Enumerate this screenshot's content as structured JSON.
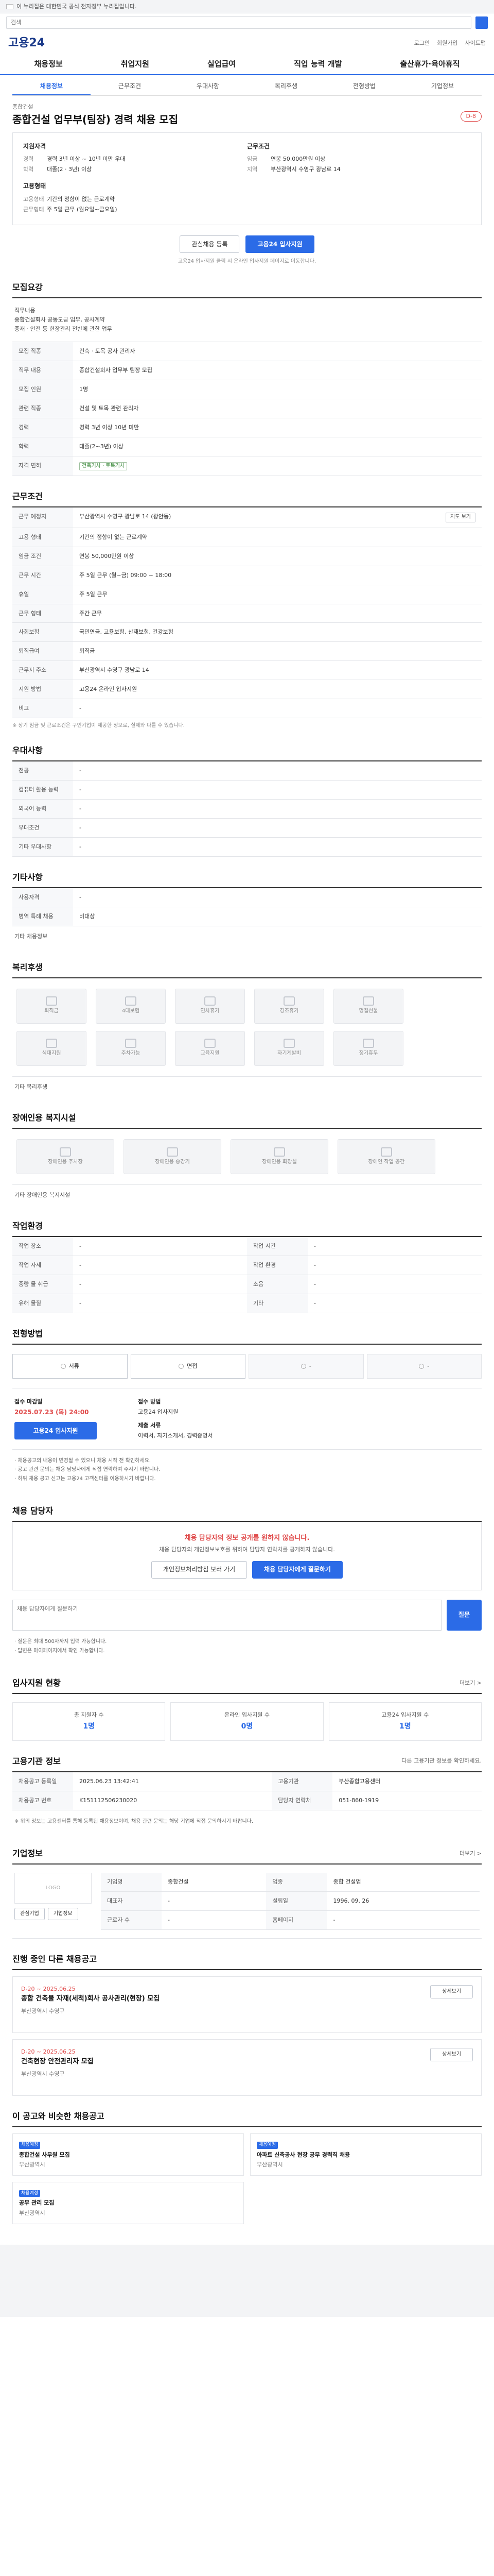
{
  "gov_banner": {
    "text": "이 누리집은 대한민국 공식 전자정부 누리집입니다."
  },
  "search": {
    "placeholder": "검색"
  },
  "header": {
    "logo": "고용24",
    "links": [
      "로그인",
      "회원가입",
      "사이트맵"
    ],
    "gnb": [
      "채용정보",
      "취업지원",
      "실업급여",
      "직업 능력 개발",
      "출산휴가·육아휴직"
    ]
  },
  "tabs": [
    "채용정보",
    "근무조건",
    "우대사항",
    "복리후생",
    "전형방법",
    "기업정보"
  ],
  "job": {
    "company": "종합건설",
    "title": "종합건설 업무부(팀장) 경력 채용 모집",
    "dday": "D-8"
  },
  "summary": {
    "left_title": "지원자격",
    "left": [
      {
        "k": "경력",
        "v": "경력 3년 이상 ~ 10년 미만 우대"
      },
      {
        "k": "학력",
        "v": "대졸(2 · 3년) 이상"
      }
    ],
    "left2_title": "고용형태",
    "left2": [
      {
        "k": "고용형태",
        "v": "기간의 정함이 없는 근로계약"
      },
      {
        "k": "근무형태",
        "v": "주 5일 근무 (월요일~금요일)"
      }
    ],
    "right_title": "근무조건",
    "right": [
      {
        "k": "임금",
        "v": "연봉 50,000만원 이상"
      },
      {
        "k": "지역",
        "v": "부산광역시 수영구 광남로 14"
      }
    ]
  },
  "actions": {
    "scrap": "관심채용 등록",
    "apply": "고용24 입사지원"
  },
  "notice": "고용24 입사지원 클릭 시 온라인 입사지원 페이지로 이동합니다.",
  "sections": {
    "recruit": "모집요강",
    "work": "근무조건",
    "pref": "우대사항",
    "other": "기타사항",
    "benefit": "복리후생",
    "disabled": "장애인용 복지시설",
    "workplace": "작업환경",
    "process": "전형방법",
    "contact": "채용 담당자",
    "status": "입사지원 현황",
    "org": "고용기관 정보",
    "company": "기업정보",
    "ongoing": "진행 중인 다른 채용공고",
    "recommend": "이 공고와 비슷한 채용공고"
  },
  "recruit_free": [
    "직무내용",
    "종합건설회사 공동도급 업무, 공사계약",
    "중재 · 안전 등 현장관리 전반에 관한 업무"
  ],
  "recruit_table": [
    {
      "k": "모집 직종",
      "v": "건축 · 토목 공사 관리자"
    },
    {
      "k": "직무 내용",
      "v": "종합건설회사 업무부 팀장 모집"
    },
    {
      "k": "모집 인원",
      "v": "1명"
    },
    {
      "k": "관련 직종",
      "v": "건설 및 토목 관련 관리자"
    },
    {
      "k": "경력",
      "v": "경력 3년 이상 10년 미만"
    },
    {
      "k": "학력",
      "v": "대졸(2~3년) 이상"
    },
    {
      "k": "자격 면허",
      "v": "건축기사 · 토목기사"
    }
  ],
  "work_table": [
    {
      "k": "근무 예정지",
      "v": "부산광역시 수영구 광남로 14 (광안동)"
    },
    {
      "k": "고용 형태",
      "v": "기간의 정함이 없는 근로계약"
    },
    {
      "k": "임금 조건",
      "v": "연봉 50,000만원 이상"
    },
    {
      "k": "근무 시간",
      "v": "주 5일 근무 (월~금) 09:00 ~ 18:00"
    },
    {
      "k": "휴일",
      "v": "주 5일 근무"
    },
    {
      "k": "근무 형태",
      "v": "주간 근무"
    },
    {
      "k": "사회보험",
      "v": "국민연금, 고용보험, 산재보험, 건강보험"
    },
    {
      "k": "퇴직급여",
      "v": "퇴직금"
    },
    {
      "k": "근무지 주소",
      "v": "부산광역시 수영구 광남로 14"
    },
    {
      "k": "지원 방법",
      "v": "고용24 온라인 입사지원"
    },
    {
      "k": "비고",
      "v": "-"
    }
  ],
  "work_note": "※ 상기 임금 및 근로조건은 구인기업이 제공한 정보로, 실제와 다를 수 있습니다.",
  "map_button": "지도 보기",
  "pref_table": [
    {
      "k": "전공",
      "v": "-"
    },
    {
      "k": "컴퓨터 활용 능력",
      "v": "-"
    },
    {
      "k": "외국어 능력",
      "v": "-"
    },
    {
      "k": "우대조건",
      "v": "-"
    },
    {
      "k": "기타 우대사항",
      "v": "-"
    }
  ],
  "other_table": [
    {
      "k": "사용자격",
      "v": "-"
    },
    {
      "k": "병역 특례 채용",
      "v": "비대상"
    }
  ],
  "other_link": "기타 채용정보",
  "benefits": [
    "퇴직금",
    "4대보험",
    "연차휴가",
    "경조휴가",
    "명절선물",
    "식대지원",
    "주차가능",
    "교육지원",
    "자기계발비",
    "정기휴무"
  ],
  "benefit_etc": "기타 복리후생",
  "disabled": [
    "장애인용 주차장",
    "장애인용 승강기",
    "장애인용 화장실",
    "장애인 작업 공간"
  ],
  "disabled_etc": "기타 장애인용 복지시설",
  "workplace_table": [
    {
      "k": "작업 장소",
      "v": "-",
      "k2": "작업 시간",
      "v2": "-"
    },
    {
      "k": "작업 자세",
      "v": "-",
      "k2": "작업 환경",
      "v2": "-"
    },
    {
      "k": "중량 물 취급",
      "v": "-",
      "k2": "소음",
      "v2": "-"
    },
    {
      "k": "유해 물질",
      "v": "-",
      "k2": "기타",
      "v2": "-"
    }
  ],
  "process_steps": [
    "서류",
    "면접",
    "-",
    "-"
  ],
  "apply": {
    "deadline_label": "접수 마감일",
    "deadline": "2025.07.23 (목) 24:00",
    "method_label": "접수 방법",
    "method": "고용24 입사지원",
    "docs_label": "제출 서류",
    "docs": "이력서, 자기소개서, 경력증명서",
    "button": "고용24 입사지원"
  },
  "apply_notes": [
    "· 채용공고의 내용이 변경될 수 있으니 채용 시작 전 확인하세요.",
    "· 공고 관련 문의는 채용 담당자에게 직접 연락하여 주시기 바랍니다.",
    "· 허위 채용 공고 신고는 고용24 고객센터를 이용하시기 바랍니다."
  ],
  "contact": {
    "alert": "채용 담당자의 정보 공개를 원하지 않습니다.",
    "alert_text": "채용 담당자의 개인정보보호를 위하여 담당자 연락처를 공개하지 않습니다.",
    "btn1": "개인정보처리방침 보러 가기",
    "btn2": "채용 담당자에게 질문하기",
    "qna_placeholder": "채용 담당자에게 질문하기",
    "qna_button": "질문",
    "qna_notes": [
      "· 질문은 최대 500자까지 입력 가능합니다.",
      "· 답변은 마이페이지에서 확인 가능합니다."
    ]
  },
  "status": {
    "title_more": "더보기 >",
    "items": [
      {
        "label": "총 지원자 수",
        "value": "1명"
      },
      {
        "label": "온라인 입사지원 수",
        "value": "0명"
      },
      {
        "label": "고용24 입사지원 수",
        "value": "1명"
      }
    ]
  },
  "org": {
    "notice": "다른 고용기관 정보를 확인하세요.",
    "rows": [
      {
        "k": "채용공고 등록일",
        "v": "2025.06.23 13:42:41",
        "k2": "고용기관",
        "v2": "부산종합고용센터"
      },
      {
        "k": "채용공고 번호",
        "v": "K151112506230020",
        "k2": "담당자 연락처",
        "v2": "051-860-1919"
      }
    ],
    "notes": [
      "※ 위의 정보는 고용센터를 통해 등록된 채용정보이며, 채용 관련 문의는 해당 기업에 직접 문의하시기 바랍니다."
    ]
  },
  "company": {
    "title_more": "더보기 >",
    "logo_alt": "LOGO",
    "rows": [
      {
        "k": "기업명",
        "v": "종합건설",
        "k2": "업종",
        "v2": "종합 건설업"
      },
      {
        "k": "대표자",
        "v": "-",
        "k2": "설립일",
        "v2": "1996. 09. 26"
      },
      {
        "k": "근로자 수",
        "v": "-",
        "k2": "홈페이지",
        "v2": "-"
      }
    ],
    "btn1": "관심기업",
    "btn2": "기업정보"
  },
  "ongoing": {
    "items": [
      {
        "date": "D-20 ~ 2025.06.25",
        "title": "종합 건축물 자재(세척)회사 공사관리(현장) 모집",
        "meta": "부산광역시 수영구"
      },
      {
        "date": "D-20 ~ 2025.06.25",
        "title": "건축현장 안전관리자 모집",
        "meta": "부산광역시 수영구"
      }
    ],
    "btn": "상세보기"
  },
  "recommend": {
    "items": [
      {
        "badge": "채용예정",
        "title": "종합건설 사무원 모집",
        "meta": "부산광역시"
      },
      {
        "badge": "채용예정",
        "title": "아파트 신축공사 현장 공무 경력직 채용",
        "meta": "부산광역시"
      },
      {
        "badge": "채용예정",
        "title": "공무 관리 모집",
        "meta": "부산광역시"
      }
    ]
  },
  "colors": {
    "primary": "#2b6be7",
    "accent": "#e04b4b"
  }
}
